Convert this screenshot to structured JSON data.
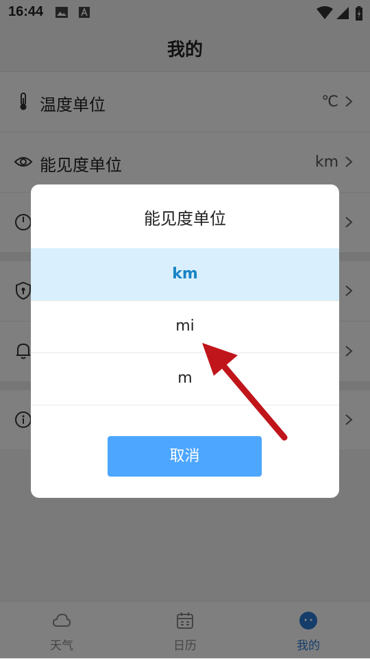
{
  "status_bar": {
    "time": "16:44"
  },
  "header": {
    "title": "我的"
  },
  "settings": {
    "items": [
      {
        "label": "温度单位",
        "value": "℃",
        "icon": "thermometer-icon"
      },
      {
        "label": "能见度单位",
        "value": "km",
        "icon": "eye-icon"
      },
      {
        "label": "",
        "value": "",
        "icon": "power-icon"
      },
      {
        "label": "",
        "value": "",
        "icon": "shield-icon"
      },
      {
        "label": "",
        "value": "",
        "icon": "bell-icon"
      },
      {
        "label": "",
        "value": "",
        "icon": "info-icon"
      }
    ]
  },
  "tabs": [
    {
      "label": "天气",
      "icon": "cloud-icon",
      "active": false
    },
    {
      "label": "日历",
      "icon": "calendar-icon",
      "active": false
    },
    {
      "label": "我的",
      "icon": "profile-icon",
      "active": true
    }
  ],
  "dialog": {
    "title": "能见度单位",
    "options": [
      {
        "label": "km",
        "selected": true
      },
      {
        "label": "mi",
        "selected": false
      },
      {
        "label": "m",
        "selected": false
      }
    ],
    "cancel_label": "取消"
  },
  "colors": {
    "accent": "#4da6ff",
    "selected_bg": "#d9effd",
    "selected_text": "#1784c6",
    "annotation_arrow": "#c0151b"
  }
}
